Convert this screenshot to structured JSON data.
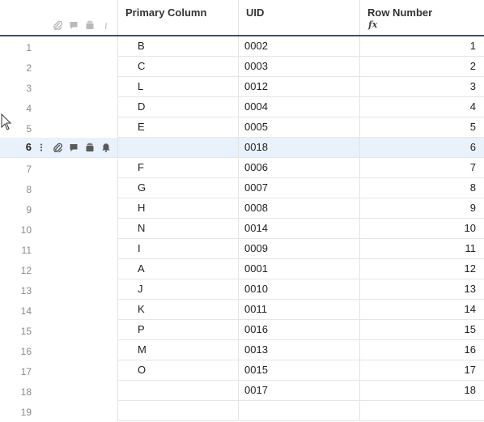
{
  "columns": {
    "primary": "Primary Column",
    "uid": "UID",
    "row_number": "Row Number",
    "row_number_formula_icon": "fx"
  },
  "header_icons": [
    "attachment-icon",
    "comment-icon",
    "proof-icon",
    "info-icon"
  ],
  "selected_row_icons": [
    "more-vert-icon",
    "attachment-icon",
    "comment-icon",
    "proof-icon",
    "reminder-bell-icon"
  ],
  "selected_row_index": 6,
  "rows": [
    {
      "num": "1",
      "primary": "B",
      "uid": "0002",
      "row_number": "1"
    },
    {
      "num": "2",
      "primary": "C",
      "uid": "0003",
      "row_number": "2"
    },
    {
      "num": "3",
      "primary": "L",
      "uid": "0012",
      "row_number": "3"
    },
    {
      "num": "4",
      "primary": "D",
      "uid": "0004",
      "row_number": "4"
    },
    {
      "num": "5",
      "primary": "E",
      "uid": "0005",
      "row_number": "5"
    },
    {
      "num": "6",
      "primary": "",
      "uid": "0018",
      "row_number": "6"
    },
    {
      "num": "7",
      "primary": "F",
      "uid": "0006",
      "row_number": "7"
    },
    {
      "num": "8",
      "primary": "G",
      "uid": "0007",
      "row_number": "8"
    },
    {
      "num": "9",
      "primary": "H",
      "uid": "0008",
      "row_number": "9"
    },
    {
      "num": "10",
      "primary": "N",
      "uid": "0014",
      "row_number": "10"
    },
    {
      "num": "11",
      "primary": "I",
      "uid": "0009",
      "row_number": "11"
    },
    {
      "num": "12",
      "primary": "A",
      "uid": "0001",
      "row_number": "12"
    },
    {
      "num": "13",
      "primary": "J",
      "uid": "0010",
      "row_number": "13"
    },
    {
      "num": "14",
      "primary": "K",
      "uid": "0011",
      "row_number": "14"
    },
    {
      "num": "15",
      "primary": "P",
      "uid": "0016",
      "row_number": "15"
    },
    {
      "num": "16",
      "primary": "M",
      "uid": "0013",
      "row_number": "16"
    },
    {
      "num": "17",
      "primary": "O",
      "uid": "0015",
      "row_number": "17"
    },
    {
      "num": "18",
      "primary": "",
      "uid": "0017",
      "row_number": "18"
    },
    {
      "num": "19",
      "primary": "",
      "uid": "",
      "row_number": ""
    }
  ],
  "colors": {
    "header_underline": "#3d4f7a",
    "selected_row_bg": "#e9f1fb",
    "icon_gray": "#b9b9b9",
    "icon_dark": "#5a5a5a"
  }
}
